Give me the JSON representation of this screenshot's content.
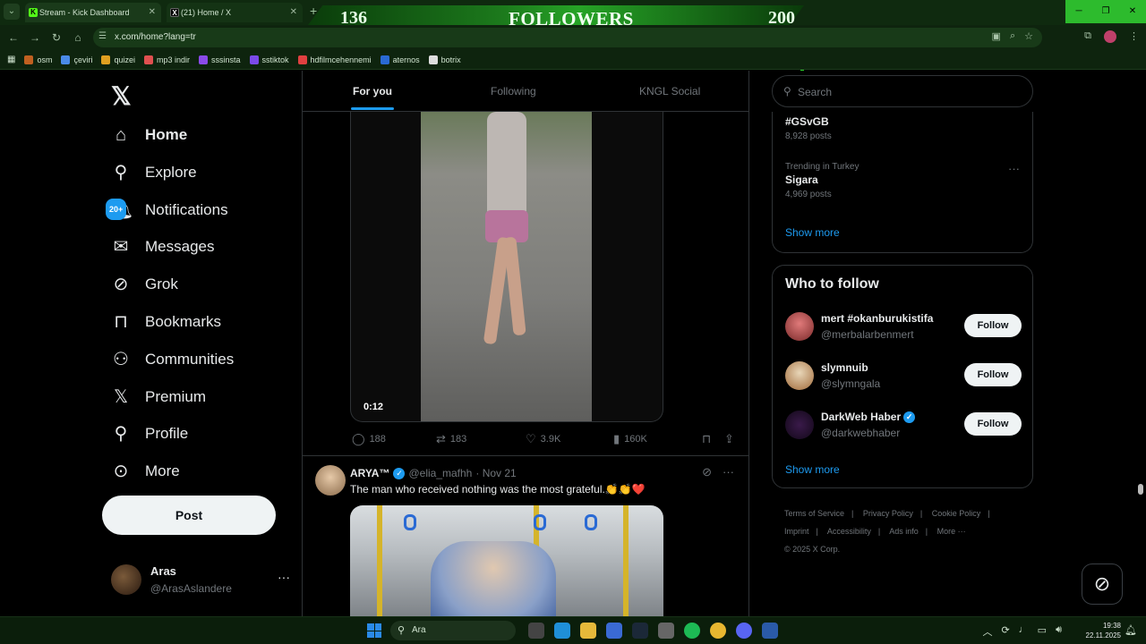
{
  "browser": {
    "tabs": [
      {
        "title": "Stream - Kick Dashboard",
        "favicon": "K"
      },
      {
        "title": "(21) Home / X",
        "favicon": "X"
      }
    ],
    "url": "x.com/home?lang=tr",
    "bookmarks": [
      "osm",
      "çeviri",
      "quizei",
      "mp3 indir",
      "sssinsta",
      "sstiktok",
      "hdfilmcehennemi",
      "aternos",
      "botrix"
    ]
  },
  "overlay": {
    "current": "136",
    "label": "FOLLOWERS",
    "goal": "200"
  },
  "nav": {
    "items": [
      {
        "label": "Home",
        "icon": "home-icon"
      },
      {
        "label": "Explore",
        "icon": "search-icon"
      },
      {
        "label": "Notifications",
        "icon": "bell-icon",
        "badge": "20+"
      },
      {
        "label": "Messages",
        "icon": "envelope-icon"
      },
      {
        "label": "Grok",
        "icon": "grok-icon"
      },
      {
        "label": "Bookmarks",
        "icon": "bookmark-icon"
      },
      {
        "label": "Communities",
        "icon": "people-icon"
      },
      {
        "label": "Premium",
        "icon": "x-logo-icon"
      },
      {
        "label": "Profile",
        "icon": "person-icon"
      },
      {
        "label": "More",
        "icon": "more-circle-icon"
      }
    ],
    "post_label": "Post",
    "account": {
      "name": "Aras",
      "handle": "@ArasAslandere"
    }
  },
  "feed": {
    "tabs": [
      "For you",
      "Following",
      "KNGL Social"
    ],
    "post1": {
      "duration": "0:12",
      "replies": "188",
      "reposts": "183",
      "likes": "3.9K",
      "views": "160K"
    },
    "post2": {
      "name": "ARYA™",
      "handle": "@elia_mafhh",
      "date": "· Nov 21",
      "text": "The man who received nothing was the most grateful.👏👏❤️"
    }
  },
  "sidebar": {
    "search_placeholder": "Search",
    "trends": [
      {
        "context": "",
        "title": "#GSvGB",
        "posts": "8,928 posts"
      },
      {
        "context": "Trending in Turkey",
        "title": "Sigara",
        "posts": "4,969 posts"
      }
    ],
    "trends_show_more": "Show more",
    "who_to_follow": {
      "title": "Who to follow",
      "accounts": [
        {
          "name": "mert #okanburukistifa",
          "handle": "@merbalarbenmert",
          "verified": false,
          "button": "Follow"
        },
        {
          "name": "slymnuib",
          "handle": "@slymngala",
          "verified": false,
          "button": "Follow"
        },
        {
          "name": "DarkWeb Haber",
          "handle": "@darkwebhaber",
          "verified": true,
          "button": "Follow"
        }
      ],
      "show_more": "Show more"
    },
    "footer": {
      "links": [
        "Terms of Service",
        "Privacy Policy",
        "Cookie Policy",
        "Imprint",
        "Accessibility",
        "Ads info",
        "More ···"
      ],
      "copyright": "© 2025 X Corp."
    }
  },
  "taskbar": {
    "search_placeholder": "Ara",
    "time": "19:38",
    "date": "22.11.2025"
  },
  "colors": {
    "accent": "#1d9bf0",
    "background": "#000000",
    "border": "#2f3336",
    "kick_green": "#53fc18"
  }
}
